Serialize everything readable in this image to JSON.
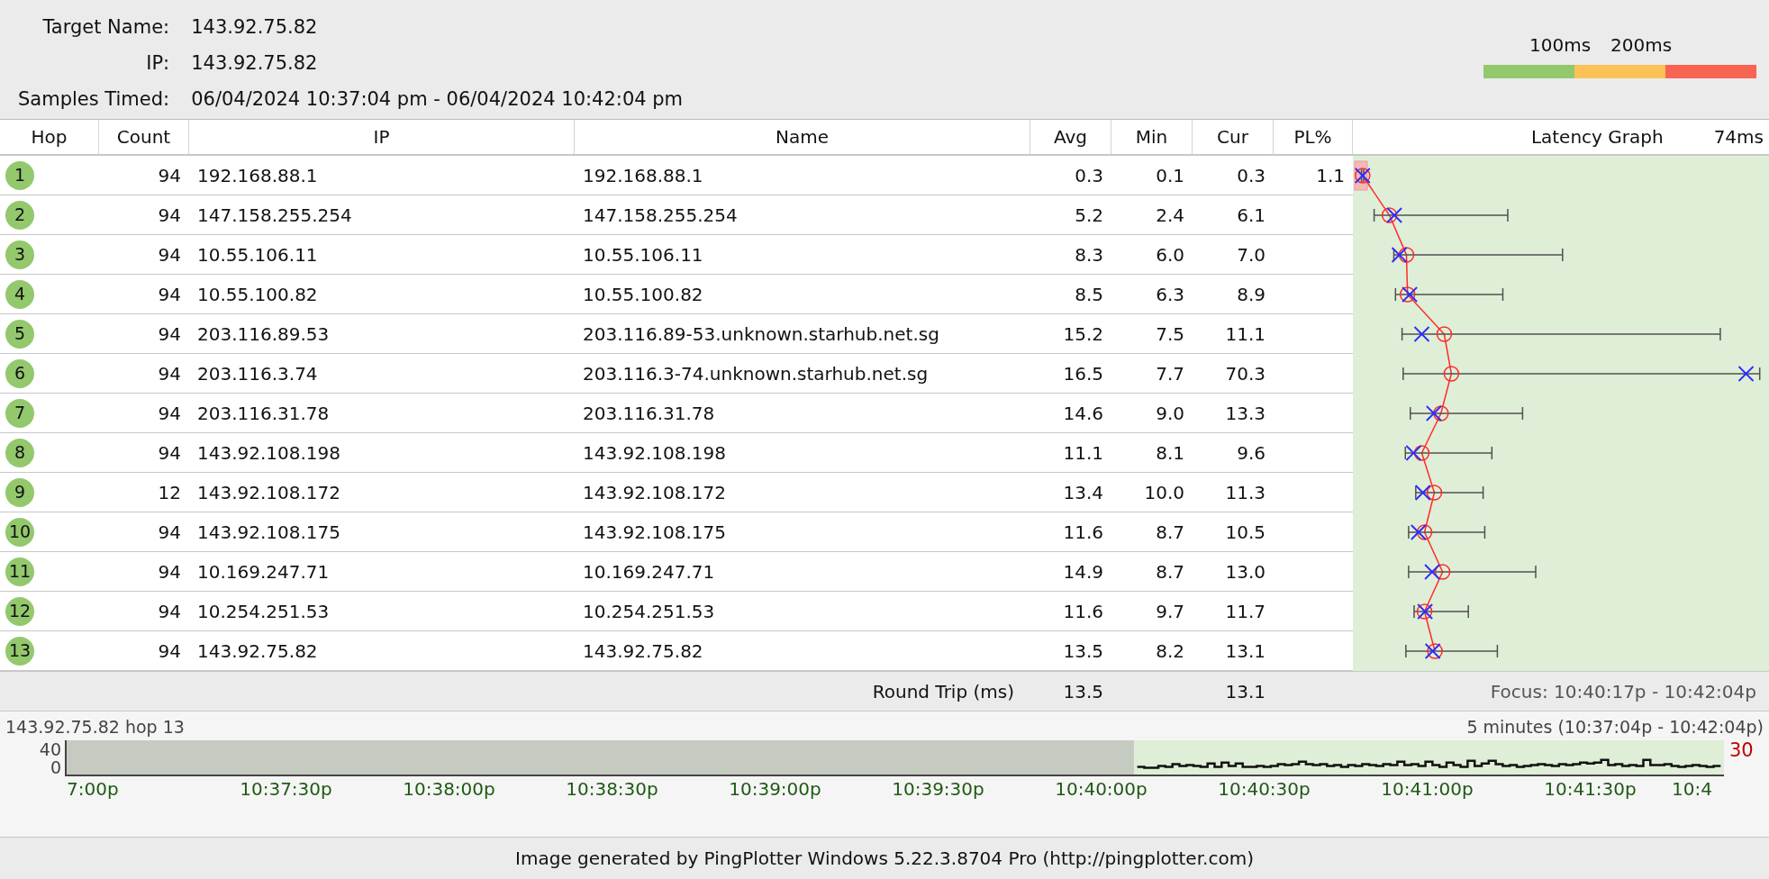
{
  "summary": {
    "fields": [
      {
        "label": "Target Name:",
        "value": "143.92.75.82"
      },
      {
        "label": "IP:",
        "value": "143.92.75.82"
      },
      {
        "label": "Samples Timed:",
        "value": "06/04/2024 10:37:04 pm - 06/04/2024 10:42:04 pm"
      }
    ]
  },
  "legend": {
    "labels": [
      "100ms",
      "200ms"
    ],
    "segments": [
      {
        "color": "#93c86d"
      },
      {
        "color": "#fdc257"
      },
      {
        "color": "#f76552"
      }
    ]
  },
  "table": {
    "columns": [
      "Hop",
      "Count",
      "IP",
      "Name",
      "Avg",
      "Min",
      "Cur",
      "PL%"
    ],
    "rows": [
      {
        "hop": "1",
        "count": "94",
        "ip": "192.168.88.1",
        "name": "192.168.88.1",
        "avg": "0.3",
        "min": "0.1",
        "cur": "0.3",
        "pl": "1.1"
      },
      {
        "hop": "2",
        "count": "94",
        "ip": "147.158.255.254",
        "name": "147.158.255.254",
        "avg": "5.2",
        "min": "2.4",
        "cur": "6.1"
      },
      {
        "hop": "3",
        "count": "94",
        "ip": "10.55.106.11",
        "name": "10.55.106.11",
        "avg": "8.3",
        "min": "6.0",
        "cur": "7.0"
      },
      {
        "hop": "4",
        "count": "94",
        "ip": "10.55.100.82",
        "name": "10.55.100.82",
        "avg": "8.5",
        "min": "6.3",
        "cur": "8.9"
      },
      {
        "hop": "5",
        "count": "94",
        "ip": "203.116.89.53",
        "name": "203.116.89-53.unknown.starhub.net.sg",
        "avg": "15.2",
        "min": "7.5",
        "cur": "11.1"
      },
      {
        "hop": "6",
        "count": "94",
        "ip": "203.116.3.74",
        "name": "203.116.3-74.unknown.starhub.net.sg",
        "avg": "16.5",
        "min": "7.7",
        "cur": "70.3"
      },
      {
        "hop": "7",
        "count": "94",
        "ip": "203.116.31.78",
        "name": "203.116.31.78",
        "avg": "14.6",
        "min": "9.0",
        "cur": "13.3"
      },
      {
        "hop": "8",
        "count": "94",
        "ip": "143.92.108.198",
        "name": "143.92.108.198",
        "avg": "11.1",
        "min": "8.1",
        "cur": "9.6"
      },
      {
        "hop": "9",
        "count": "12",
        "ip": "143.92.108.172",
        "name": "143.92.108.172",
        "avg": "13.4",
        "min": "10.0",
        "cur": "11.3"
      },
      {
        "hop": "10",
        "count": "94",
        "ip": "143.92.108.175",
        "name": "143.92.108.175",
        "avg": "11.6",
        "min": "8.7",
        "cur": "10.5"
      },
      {
        "hop": "11",
        "count": "94",
        "ip": "10.169.247.71",
        "name": "10.169.247.71",
        "avg": "14.9",
        "min": "8.7",
        "cur": "13.0"
      },
      {
        "hop": "12",
        "count": "94",
        "ip": "10.254.251.53",
        "name": "10.254.251.53",
        "avg": "11.6",
        "min": "9.7",
        "cur": "11.7"
      },
      {
        "hop": "13",
        "count": "94",
        "ip": "143.92.75.82",
        "name": "143.92.75.82",
        "avg": "13.5",
        "min": "8.2",
        "cur": "13.1"
      }
    ]
  },
  "latency_graph": {
    "title": "Latency Graph",
    "scale_label": "74ms"
  },
  "round_trip": {
    "label": "Round Trip (ms)",
    "avg": "13.5",
    "cur": "13.1",
    "focus": "Focus: 10:40:17p - 10:42:04p"
  },
  "history": {
    "title": "143.92.75.82 hop 13",
    "range": "5 minutes (10:37:04p - 10:42:04p)",
    "yticks": [
      "40",
      "0"
    ],
    "scale_label": "30",
    "xticks": [
      "7:00p",
      "10:37:30p",
      "10:38:00p",
      "10:38:30p",
      "10:39:00p",
      "10:39:30p",
      "10:40:00p",
      "10:40:30p",
      "10:41:00p",
      "10:41:30p",
      "10:4"
    ]
  },
  "footer": "Image generated by PingPlotter Windows 5.22.3.8704 Pro (http://pingplotter.com)"
}
